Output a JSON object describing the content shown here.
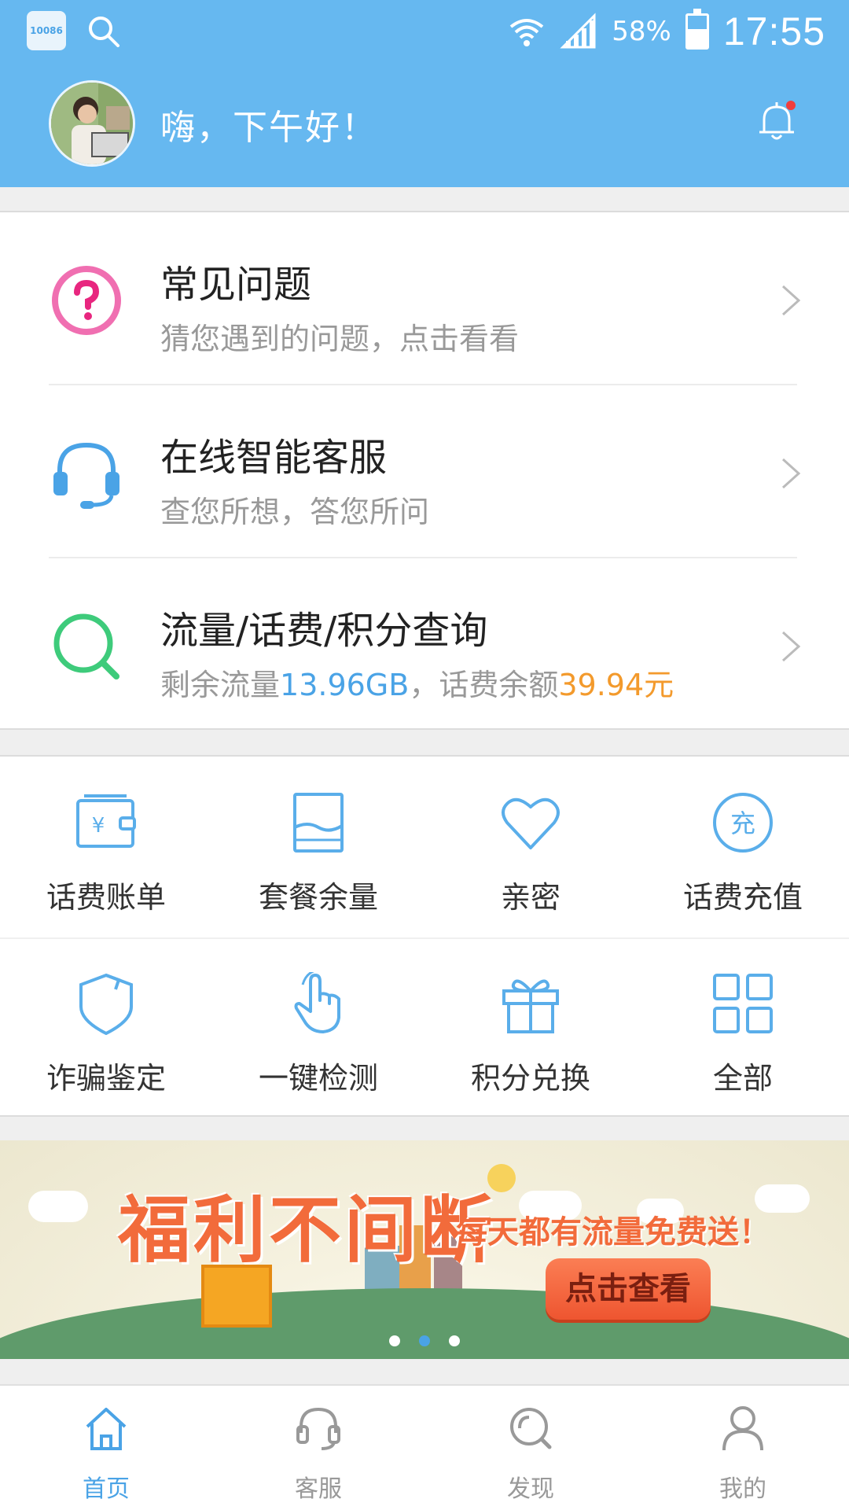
{
  "status_bar": {
    "app_badge": "10086",
    "battery_percent": "58%",
    "battery_level": 0.58,
    "time": "17:55"
  },
  "header": {
    "greeting": "嗨，下午好！",
    "has_notification": true
  },
  "menu_list": [
    {
      "title": "常见问题",
      "subtitle": "猜您遇到的问题，点击看看",
      "icon": "question-circle-icon",
      "icon_color": "#f06fb1"
    },
    {
      "title": "在线智能客服",
      "subtitle": "查您所想，答您所问",
      "icon": "headset-icon",
      "icon_color": "#4aa3e6"
    },
    {
      "title": "流量/话费/积分查询",
      "subtitle_parts": {
        "prefix": "剩余流量",
        "data_value": "13.96GB",
        "middle": "，话费余额",
        "balance_value": "39.94元"
      },
      "icon": "search-icon",
      "icon_color": "#3ecb7b"
    }
  ],
  "service_grid": [
    {
      "label": "话费账单",
      "icon": "bill-wallet-icon"
    },
    {
      "label": "套餐余量",
      "icon": "package-balance-icon"
    },
    {
      "label": "亲密",
      "icon": "heart-icon"
    },
    {
      "label": "话费充值",
      "icon": "recharge-icon"
    },
    {
      "label": "诈骗鉴定",
      "icon": "shield-icon"
    },
    {
      "label": "一键检测",
      "icon": "tap-finger-icon"
    },
    {
      "label": "积分兑换",
      "icon": "gift-icon"
    },
    {
      "label": "全部",
      "icon": "grid-all-icon"
    }
  ],
  "banner": {
    "title": "福利不间断",
    "slogan": "每天都有流量免费送！",
    "cta": "点击查看",
    "active_dot": 1,
    "dot_count": 3
  },
  "tabbar": [
    {
      "label": "首页",
      "icon": "home-icon",
      "active": true
    },
    {
      "label": "客服",
      "icon": "headset-icon",
      "active": false
    },
    {
      "label": "发现",
      "icon": "discover-icon",
      "active": false
    },
    {
      "label": "我的",
      "icon": "user-icon",
      "active": false
    }
  ],
  "colors": {
    "header_bg": "#66b8f0",
    "accent_blue": "#4aa3e6",
    "accent_orange": "#f39a2c",
    "banner_red": "#f26b3b"
  }
}
